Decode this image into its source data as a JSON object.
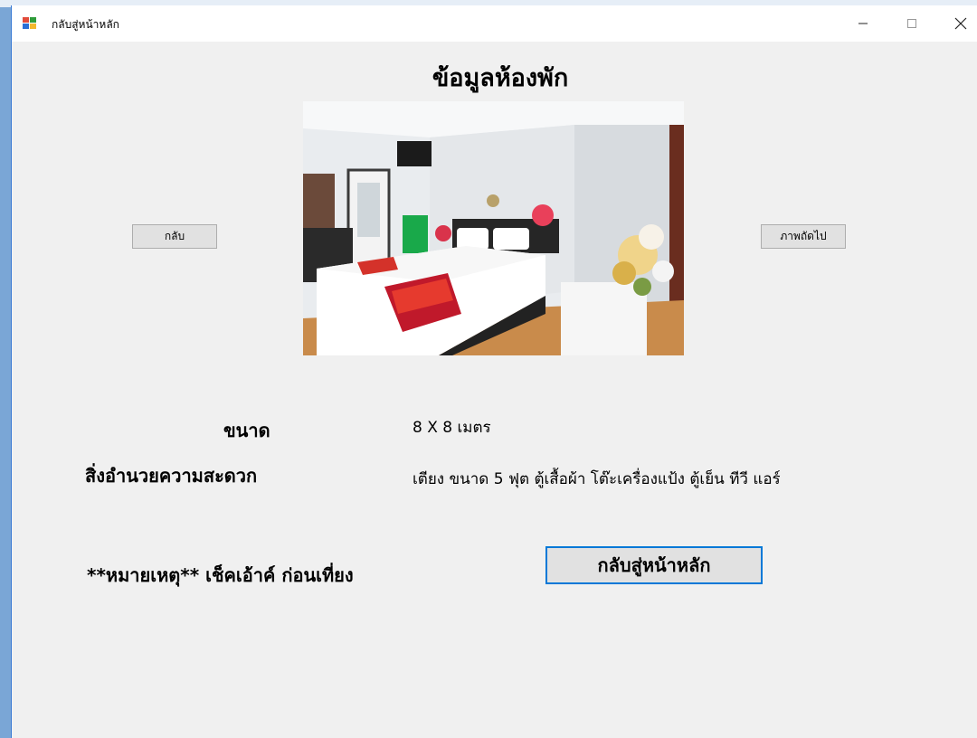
{
  "window": {
    "title": "กลับสู่หน้าหลัก",
    "minimize_glyph": "—",
    "maximize_glyph": "☐",
    "close_glyph": "✕"
  },
  "main": {
    "heading": "ข้อมูลห้องพัก",
    "photo_icon": "bedroom-photo",
    "back_label": "กลับ",
    "next_label": "ภาพถัดไป"
  },
  "details": {
    "size_label": "ขนาด",
    "size_value": "8 X 8 เมตร",
    "amenities_label": "สิ่งอำนวยความสะดวก",
    "amenities_value": "เตียง ขนาด 5 ฟุต ตู้เสื้อผ้า โต๊ะเครื่องแป้ง ตู้เย็น ทีวี แอร์"
  },
  "note": "**หมายเหตุ** เช็คเอ้าค์ ก่อนเที่ยง",
  "main_button_label": "กลับสู่หน้าหลัก",
  "colors": {
    "client_bg": "#f0f0f0",
    "accent": "#0078d7",
    "button_bg": "#e1e1e1"
  }
}
